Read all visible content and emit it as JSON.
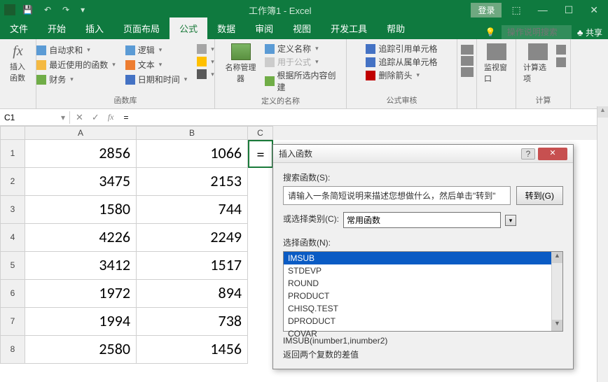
{
  "titlebar": {
    "title": "工作簿1 - Excel",
    "login": "登录"
  },
  "tabs": {
    "file": "文件",
    "home": "开始",
    "insert": "插入",
    "layout": "页面布局",
    "formula": "公式",
    "data": "数据",
    "review": "审阅",
    "view": "视图",
    "dev": "开发工具",
    "help": "帮助",
    "search_placeholder": "操作说明搜索",
    "share": "共享"
  },
  "ribbon": {
    "insert_fn": "插入函数",
    "autosum": "自动求和",
    "recent": "最近使用的函数",
    "financial": "财务",
    "logical": "逻辑",
    "text": "文本",
    "datetime": "日期和时间",
    "lookup": "",
    "math": "",
    "more": "",
    "lib_label": "函数库",
    "name_mgr": "名称管理器",
    "define_name": "定义名称",
    "use_in_formula": "用于公式",
    "create_from_sel": "根据所选内容创建",
    "names_label": "定义的名称",
    "trace_prec": "追踪引用单元格",
    "trace_dep": "追踪从属单元格",
    "remove_arrows": "删除箭头",
    "audit_label": "公式审核",
    "watch": "监视窗口",
    "calc_opts": "计算选项",
    "calc_label": "计算"
  },
  "namebox": "C1",
  "formula": "=",
  "cols": [
    "A",
    "B",
    "C"
  ],
  "rows": [
    {
      "n": "1",
      "a": "2856",
      "b": "1066",
      "c": "="
    },
    {
      "n": "2",
      "a": "3475",
      "b": "2153",
      "c": ""
    },
    {
      "n": "3",
      "a": "1580",
      "b": "744",
      "c": ""
    },
    {
      "n": "4",
      "a": "4226",
      "b": "2249",
      "c": ""
    },
    {
      "n": "5",
      "a": "3412",
      "b": "1517",
      "c": ""
    },
    {
      "n": "6",
      "a": "1972",
      "b": "894",
      "c": ""
    },
    {
      "n": "7",
      "a": "1994",
      "b": "738",
      "c": ""
    },
    {
      "n": "8",
      "a": "2580",
      "b": "1456",
      "c": ""
    }
  ],
  "dialog": {
    "title": "插入函数",
    "search_label": "搜索函数(S):",
    "search_placeholder": "请输入一条简短说明来描述您想做什么，然后单击\"转到\"",
    "go": "转到(G)",
    "cat_label": "或选择类别(C):",
    "cat_value": "常用函数",
    "sel_label": "选择函数(N):",
    "functions": [
      "IMSUB",
      "STDEVP",
      "ROUND",
      "PRODUCT",
      "CHISQ.TEST",
      "DPRODUCT",
      "COVAR"
    ],
    "signature": "IMSUB(inumber1,inumber2)",
    "description": "返回两个复数的差值"
  }
}
